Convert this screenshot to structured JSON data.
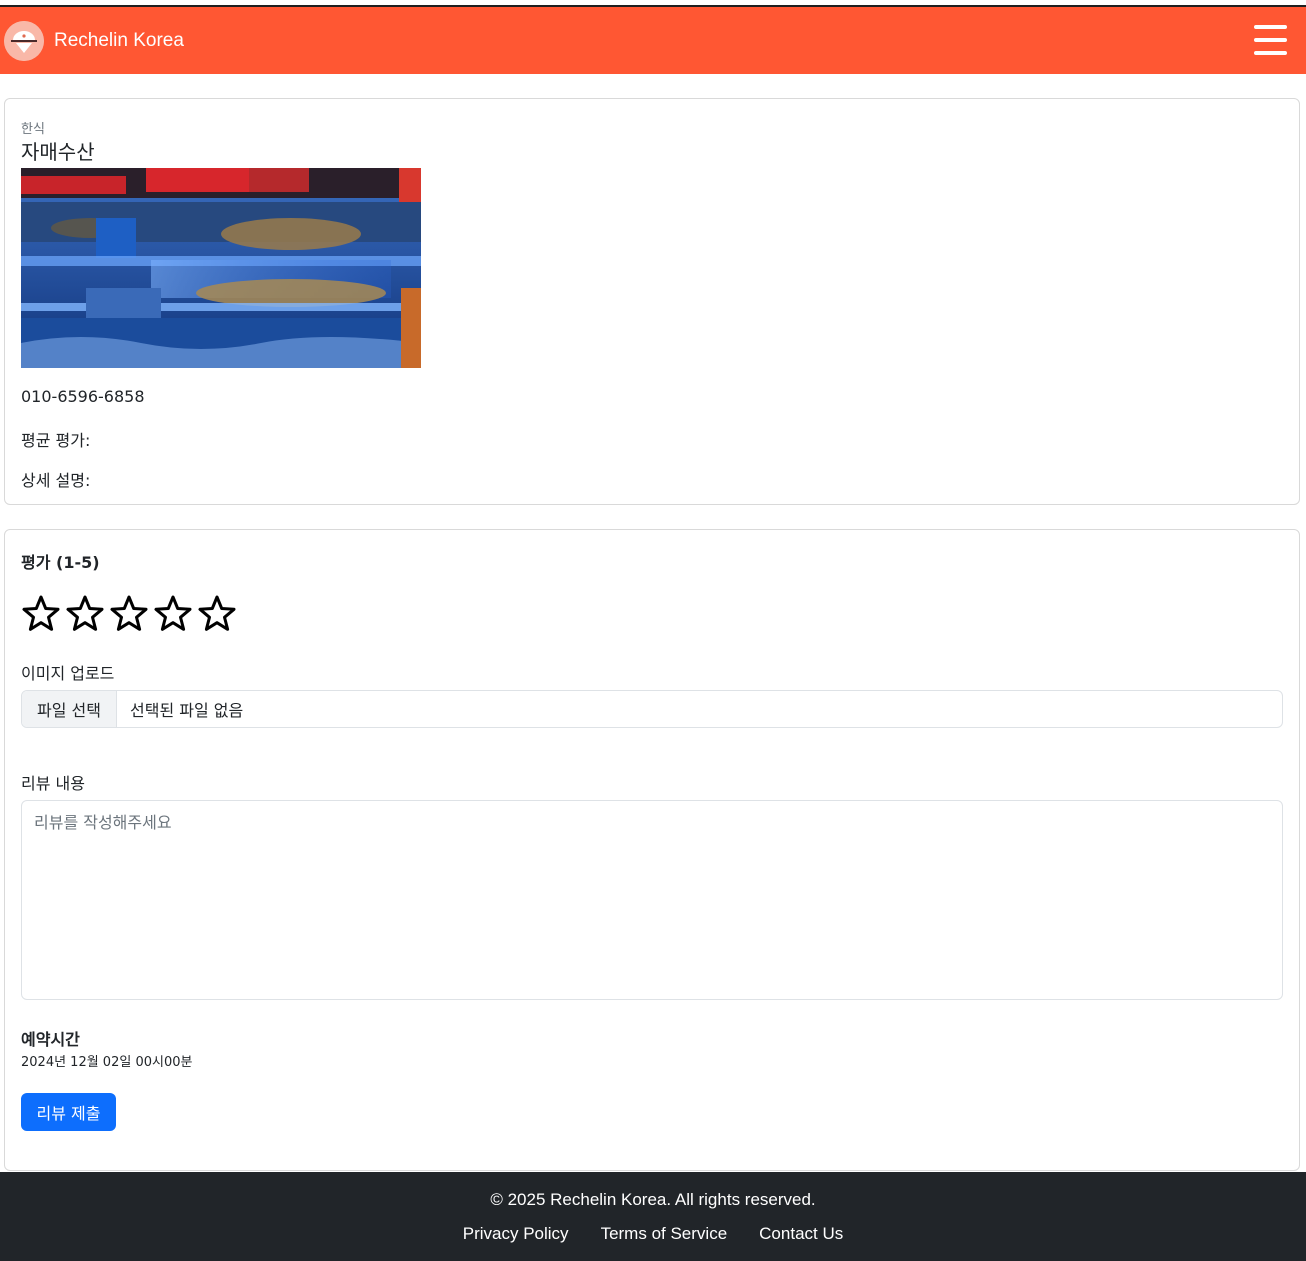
{
  "brand": {
    "name": "Rechelin Korea",
    "logo_icon": "restaurant-logo-icon",
    "menu_icon": "hamburger-menu-icon"
  },
  "colors": {
    "navbar": "#ff5733",
    "primary": "#0d6efd",
    "footer": "#212529"
  },
  "restaurant": {
    "category": "한식",
    "name": "자매수산",
    "photo": "seafood-tank-photo",
    "phone": "010-6596-6858",
    "avg_rating_label": "평균 평가:",
    "description_label": "상세 설명:"
  },
  "review_form": {
    "rating_label": "평가 (1-5)",
    "rating_value": 0,
    "rating_max": 5,
    "star_icon": "star-outline-icon",
    "upload_label": "이미지 업로드",
    "file_button": "파일 선택",
    "file_status": "선택된 파일 없음",
    "review_label": "리뷰 내용",
    "review_placeholder": "리뷰를 작성해주세요",
    "reservation_label": "예약시간",
    "reservation_time": "2024년 12월 02일 00시00분",
    "submit_label": "리뷰 제출"
  },
  "footer": {
    "copyright": "© 2025 Rechelin Korea. All rights reserved.",
    "links": [
      "Privacy Policy",
      "Terms of Service",
      "Contact Us"
    ]
  }
}
